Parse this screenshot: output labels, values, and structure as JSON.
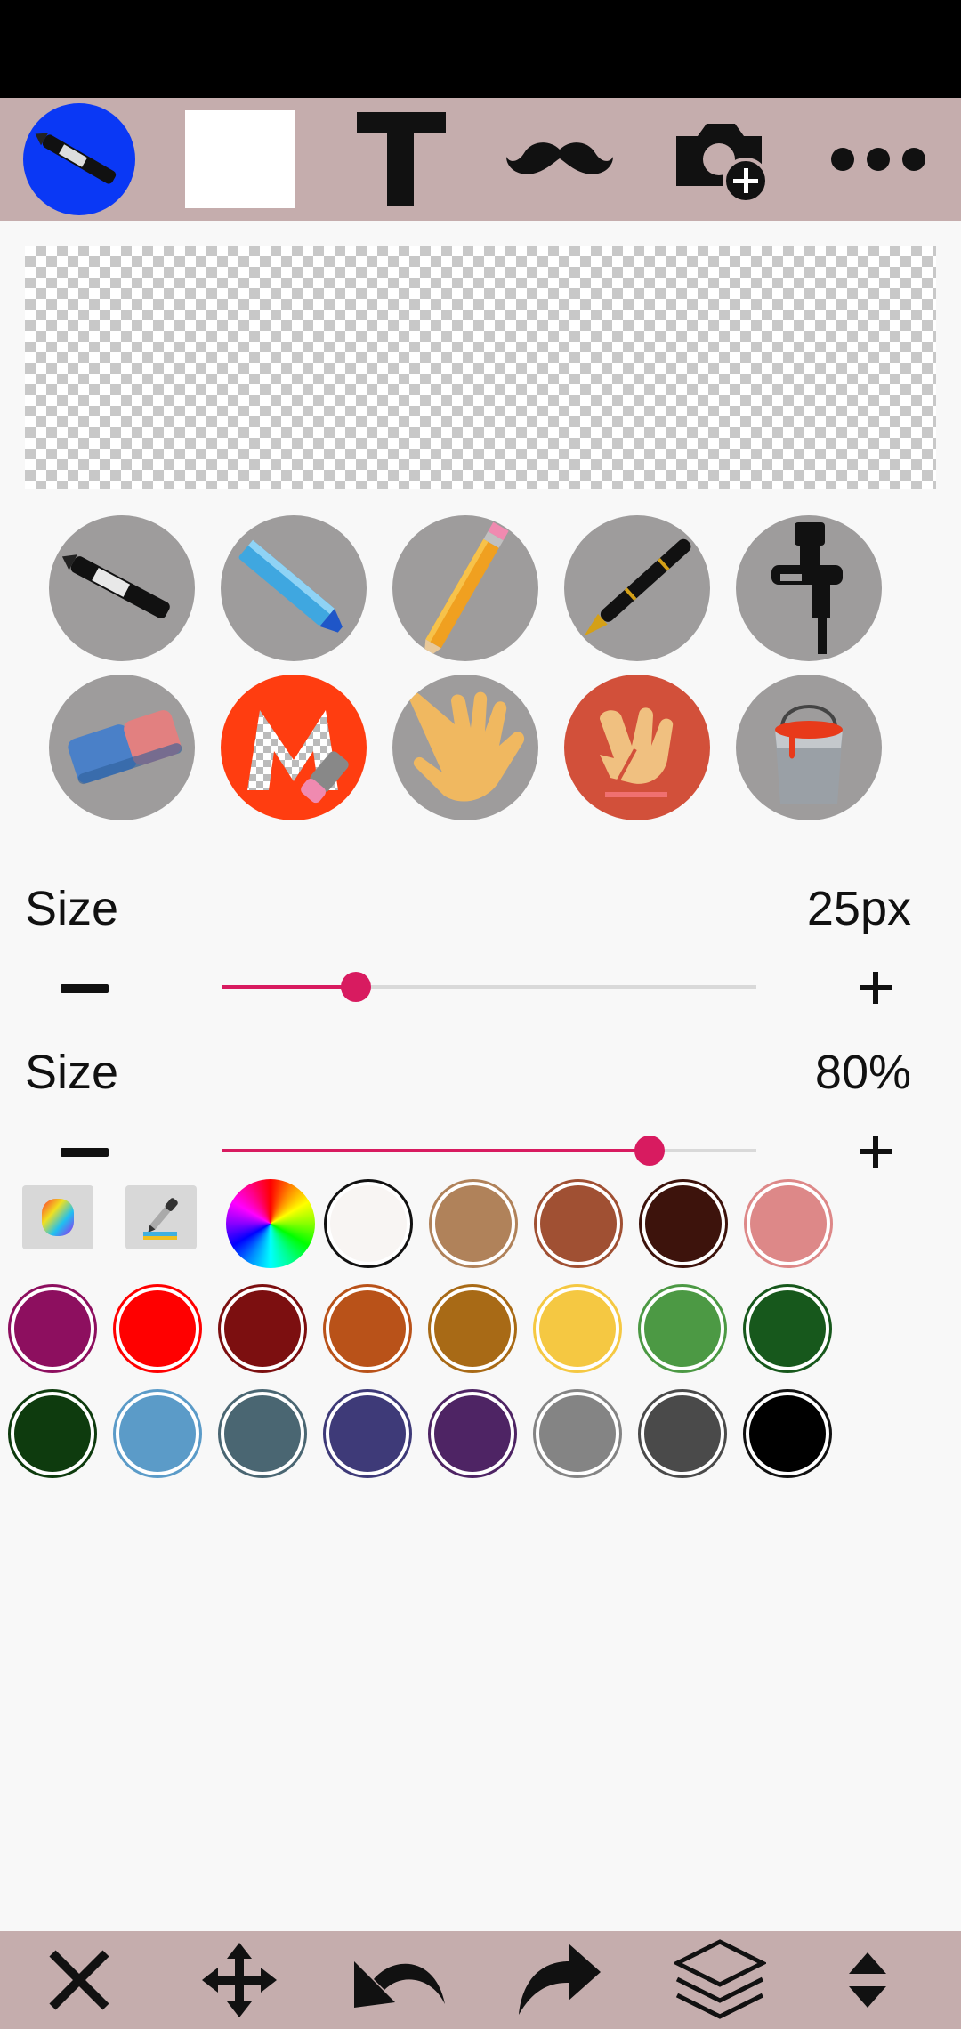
{
  "toolbar": {
    "icons": [
      "brush-marker-icon",
      "color-swatch",
      "text-tool-icon",
      "mustache-sticker-icon",
      "camera-add-icon",
      "more-icon"
    ],
    "selected_color": "#ffffff",
    "active_bg": "#0a38f5"
  },
  "tools": {
    "row1": [
      "marker",
      "highlighter",
      "pencil",
      "fountain-pen",
      "airbrush"
    ],
    "row2": [
      "eraser",
      "transparency-eraser",
      "hand-pan",
      "finger-smudge",
      "paint-bucket"
    ]
  },
  "size_slider": {
    "label": "Size",
    "value_text": "25px",
    "fraction": 0.25
  },
  "opacity_slider": {
    "label": "Size",
    "value_text": "80%",
    "fraction": 0.8
  },
  "colors": {
    "row1": [
      "#f8f5f3",
      "#b0825a",
      "#a05033",
      "#3d130c",
      "#dd8888"
    ],
    "row2": [
      "#8d0f5f",
      "#ff0000",
      "#7c0f10",
      "#b95219",
      "#a86a16",
      "#f5c842",
      "#4c9944",
      "#17581c"
    ],
    "row3": [
      "#0e3b0e",
      "#5b9bc8",
      "#4a6672",
      "#3e3a78",
      "#4e2464",
      "#848484",
      "#4a4a4a",
      "#000000"
    ]
  },
  "accent": "#d81b60",
  "bottom_toolbar": {
    "icons": [
      "close-icon",
      "move-icon",
      "undo-icon",
      "redo-icon",
      "layers-icon",
      "expand-icon"
    ]
  }
}
